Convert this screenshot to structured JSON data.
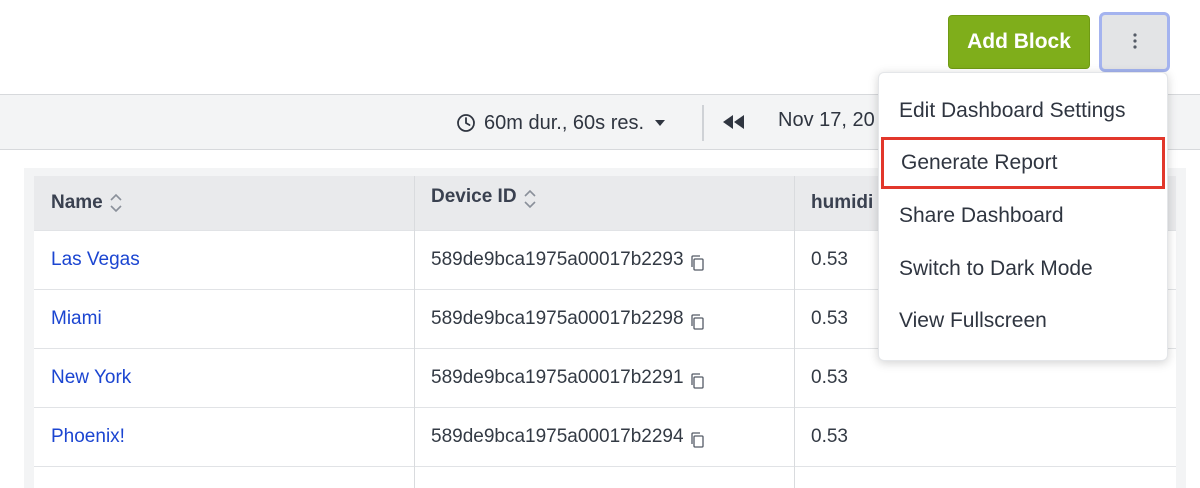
{
  "header": {
    "add_block_label": "Add Block",
    "more_menu_icon": "kebab-vertical-icon",
    "colors": {
      "add_block_bg": "#7fae1b",
      "kebab_focus_ring": "#a4b3ef"
    }
  },
  "toolbar": {
    "duration_label": "60m dur., 60s res.",
    "duration_icon": "clock-icon",
    "rewind_icon": "rewind-icon",
    "date_text": "Nov 17, 20"
  },
  "table": {
    "columns": [
      {
        "label": "Name",
        "sortable": true
      },
      {
        "label": "Device ID",
        "sortable": true
      },
      {
        "label": "humidi",
        "sortable": false
      }
    ],
    "rows": [
      {
        "name": "Las Vegas",
        "device_id": "589de9bca1975a00017b2293",
        "humidity": "0.53"
      },
      {
        "name": "Miami",
        "device_id": "589de9bca1975a00017b2298",
        "humidity": "0.53"
      },
      {
        "name": "New York",
        "device_id": "589de9bca1975a00017b2291",
        "humidity": "0.53"
      },
      {
        "name": "Phoenix!",
        "device_id": "589de9bca1975a00017b2294",
        "humidity": "0.53"
      }
    ],
    "colors": {
      "link": "#1b45d1"
    }
  },
  "menu": {
    "items": [
      {
        "label": "Edit Dashboard Settings",
        "highlighted": false
      },
      {
        "label": "Generate Report",
        "highlighted": true
      },
      {
        "label": "Share Dashboard",
        "highlighted": false
      },
      {
        "label": "Switch to Dark Mode",
        "highlighted": false
      },
      {
        "label": "View Fullscreen",
        "highlighted": false
      }
    ],
    "colors": {
      "highlight_border": "#e2372b"
    }
  }
}
